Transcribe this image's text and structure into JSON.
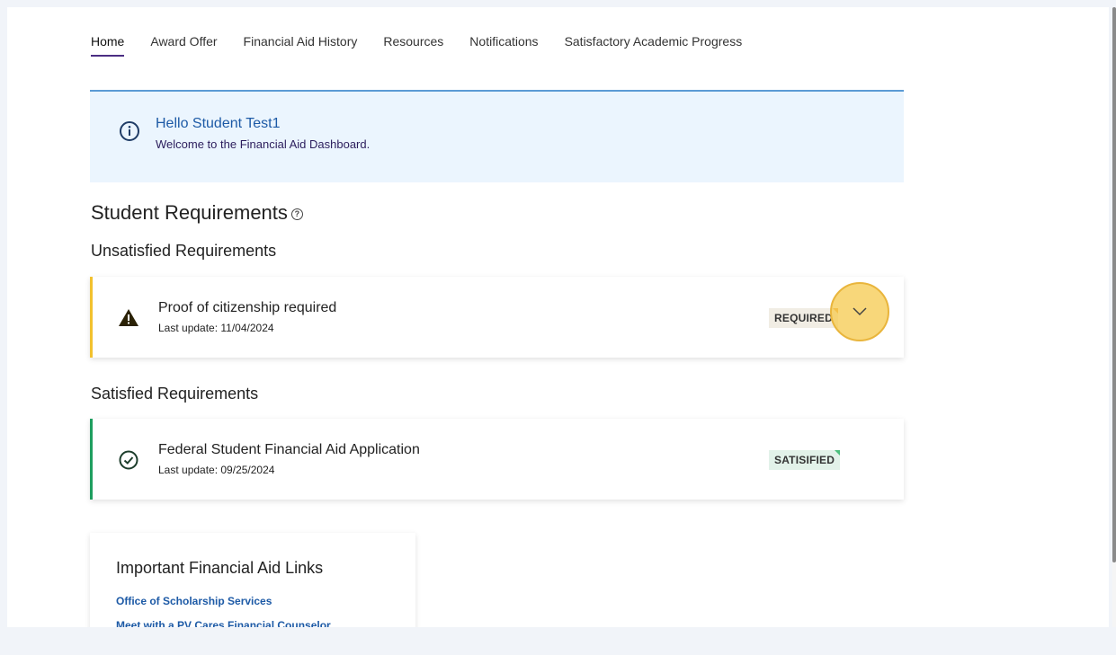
{
  "nav": {
    "tabs": [
      {
        "label": "Home",
        "active": true
      },
      {
        "label": "Award Offer"
      },
      {
        "label": "Financial Aid History"
      },
      {
        "label": "Resources"
      },
      {
        "label": "Notifications"
      },
      {
        "label": "Satisfactory Academic Progress"
      }
    ]
  },
  "welcome": {
    "icon": "info-icon",
    "title": "Hello Student Test1",
    "subtitle": "Welcome to the Financial Aid Dashboard."
  },
  "requirements": {
    "title": "Student Requirements",
    "help_icon": "?",
    "unsatisfied_title": "Unsatisfied Requirements",
    "unsatisfied": [
      {
        "name": "Proof of citizenship required",
        "date": "Last update: 11/04/2024",
        "status": "REQUIRED",
        "icon": "warning-icon"
      }
    ],
    "satisfied_title": "Satisfied Requirements",
    "satisfied": [
      {
        "name": "Federal Student Financial Aid Application",
        "date": "Last update: 09/25/2024",
        "status": "SATISIFIED",
        "icon": "check-circle-icon"
      }
    ]
  },
  "links": {
    "title": "Important Financial Aid Links",
    "items": [
      "Office of Scholarship Services",
      "Meet with a PV Cares Financial Counselor"
    ]
  },
  "colors": {
    "accent": "#4b2e83",
    "info_bg": "#ebf5fe",
    "required_border": "#f2c12e",
    "satisfied_border": "#1e9e5f",
    "link": "#1d5aa6"
  }
}
